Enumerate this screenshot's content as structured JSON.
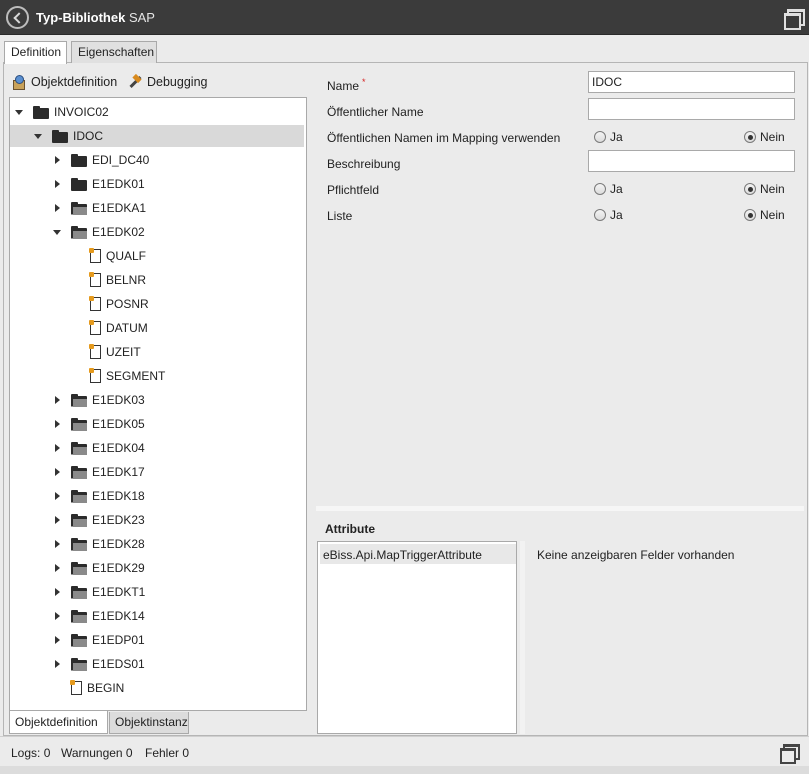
{
  "window": {
    "title_bold": "Typ-Bibliothek",
    "title_rest": "SAP"
  },
  "tabs_top": [
    {
      "label": "Definition",
      "active": true
    },
    {
      "label": "Eigenschaften",
      "active": false
    }
  ],
  "toolbar": {
    "objektdefinition_label": "Objektdefinition",
    "debugging_label": "Debugging"
  },
  "tree": [
    {
      "label": "INVOIC02",
      "level": 0,
      "type": "folder",
      "state": "expanded",
      "selected": false
    },
    {
      "label": "IDOC",
      "level": 1,
      "type": "folder",
      "state": "expanded",
      "selected": true
    },
    {
      "label": "EDI_DC40",
      "level": 2,
      "type": "folder",
      "state": "collapsed",
      "selected": false
    },
    {
      "label": "E1EDK01",
      "level": 2,
      "type": "folder",
      "state": "collapsed",
      "selected": false
    },
    {
      "label": "E1EDKA1",
      "level": 2,
      "type": "folder-open",
      "state": "collapsed",
      "selected": false
    },
    {
      "label": "E1EDK02",
      "level": 2,
      "type": "folder-open",
      "state": "expanded",
      "selected": false
    },
    {
      "label": "QUALF",
      "level": 3,
      "type": "file",
      "state": "none",
      "selected": false
    },
    {
      "label": "BELNR",
      "level": 3,
      "type": "file",
      "state": "none",
      "selected": false
    },
    {
      "label": "POSNR",
      "level": 3,
      "type": "file",
      "state": "none",
      "selected": false
    },
    {
      "label": "DATUM",
      "level": 3,
      "type": "file",
      "state": "none",
      "selected": false
    },
    {
      "label": "UZEIT",
      "level": 3,
      "type": "file",
      "state": "none",
      "selected": false
    },
    {
      "label": "SEGMENT",
      "level": 3,
      "type": "file",
      "state": "none",
      "selected": false
    },
    {
      "label": "E1EDK03",
      "level": 2,
      "type": "folder-open",
      "state": "collapsed",
      "selected": false
    },
    {
      "label": "E1EDK05",
      "level": 2,
      "type": "folder-open",
      "state": "collapsed",
      "selected": false
    },
    {
      "label": "E1EDK04",
      "level": 2,
      "type": "folder-open",
      "state": "collapsed",
      "selected": false
    },
    {
      "label": "E1EDK17",
      "level": 2,
      "type": "folder-open",
      "state": "collapsed",
      "selected": false
    },
    {
      "label": "E1EDK18",
      "level": 2,
      "type": "folder-open",
      "state": "collapsed",
      "selected": false
    },
    {
      "label": "E1EDK23",
      "level": 2,
      "type": "folder-open",
      "state": "collapsed",
      "selected": false
    },
    {
      "label": "E1EDK28",
      "level": 2,
      "type": "folder-open",
      "state": "collapsed",
      "selected": false
    },
    {
      "label": "E1EDK29",
      "level": 2,
      "type": "folder-open",
      "state": "collapsed",
      "selected": false
    },
    {
      "label": "E1EDKT1",
      "level": 2,
      "type": "folder-open",
      "state": "collapsed",
      "selected": false
    },
    {
      "label": "E1EDK14",
      "level": 2,
      "type": "folder-open",
      "state": "collapsed",
      "selected": false
    },
    {
      "label": "E1EDP01",
      "level": 2,
      "type": "folder-open",
      "state": "collapsed",
      "selected": false
    },
    {
      "label": "E1EDS01",
      "level": 2,
      "type": "folder-open",
      "state": "collapsed",
      "selected": false
    },
    {
      "label": "BEGIN",
      "level": 2,
      "type": "file",
      "state": "none",
      "selected": false
    }
  ],
  "tabs_bottom": [
    {
      "label": "Objektdefinition",
      "active": true
    },
    {
      "label": "Objektinstanz",
      "active": false
    }
  ],
  "form": {
    "name_label": "Name",
    "required_marker": "*",
    "name_value": "IDOC",
    "public_name_label": "Öffentlicher Name",
    "public_name_value": "",
    "use_public_name_label": "Öffentlichen Namen im Mapping verwenden",
    "description_label": "Beschreibung",
    "description_value": "",
    "required_label": "Pflichtfeld",
    "list_label": "Liste",
    "yes_label": "Ja",
    "no_label": "Nein",
    "use_public_name_selected": "Nein",
    "required_selected": "Nein",
    "list_selected": "Nein"
  },
  "attributes": {
    "title": "Attribute",
    "items": [
      "eBiss.Api.MapTriggerAttribute"
    ],
    "empty_text": "Keine anzeigbaren Felder vorhanden"
  },
  "status": {
    "logs": "Logs: 0",
    "warnings": "Warnungen 0",
    "errors": "Fehler 0"
  },
  "icons": {
    "back": "back-arrow-icon",
    "maximize": "restore-window-icon",
    "objektdefinition": "package-icon",
    "debugging": "hammer-icon",
    "folder": "folder-icon",
    "file": "document-icon"
  }
}
